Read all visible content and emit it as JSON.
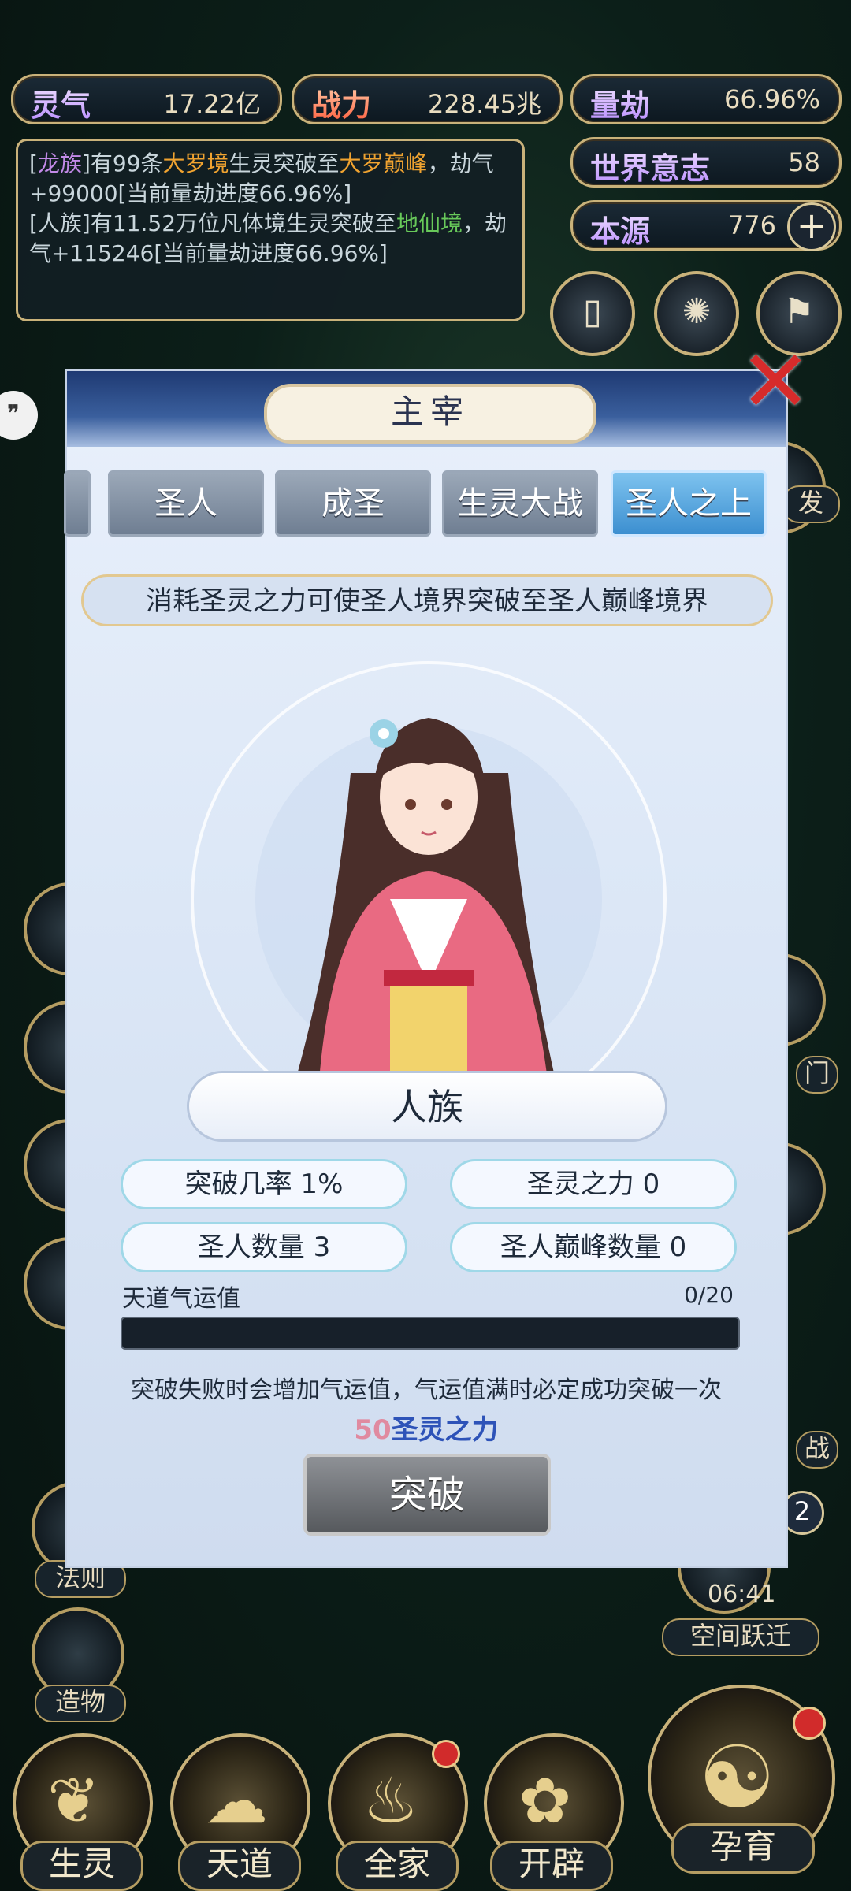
{
  "resources": {
    "lingqi": {
      "label": "灵气",
      "value": "17.22亿"
    },
    "zhanli": {
      "label": "战力",
      "value": "228.45兆"
    },
    "liangjie": {
      "label": "量劫",
      "value": "66.96%"
    },
    "shijie": {
      "label": "世界意志",
      "value": "58"
    },
    "benyuan": {
      "label": "本源",
      "value": "776"
    }
  },
  "log": {
    "line1_a": "[",
    "line1_race": "龙族",
    "line1_b": "]有99条",
    "line1_realm": "大罗境",
    "line1_c": "生灵突破至",
    "line1_target": "大罗巅峰",
    "line1_d": "，劫气+99000[当前量劫进度66.96%]",
    "line2_a": "[人族]有11.52万位凡体境生灵突破至",
    "line2_target": "地仙境",
    "line2_b": "，劫气+115246[当前量劫进度66.96%]"
  },
  "modal": {
    "title": "主宰",
    "tabs": [
      "圣人",
      "成圣",
      "生灵大战",
      "圣人之上"
    ],
    "active_tab": "圣人之上",
    "description": "消耗圣灵之力可使圣人境界突破至圣人巅峰境界",
    "race_name": "人族",
    "stats": {
      "chance": "突破几率 1%",
      "power": "圣灵之力 0",
      "saints": "圣人数量 3",
      "peak": "圣人巅峰数量 0"
    },
    "luck_label": "天道气运值",
    "luck_value": "0/20",
    "luck_fraction": 0.0,
    "note": "突破失败时会增加气运值，气运值满时必定成功突破一次",
    "cost_num": "50",
    "cost_text": "圣灵之力",
    "break_button": "突破"
  },
  "side": {
    "left_labels": [
      "法则",
      "造物"
    ],
    "right_labels": [
      "空间跃迁"
    ],
    "timer": "06:41",
    "badge": "2",
    "partial_right": "发",
    "partial_right2": "门",
    "partial_right3": "战"
  },
  "dock": [
    "生灵",
    "天道",
    "全家",
    "开辟",
    "孕育"
  ]
}
